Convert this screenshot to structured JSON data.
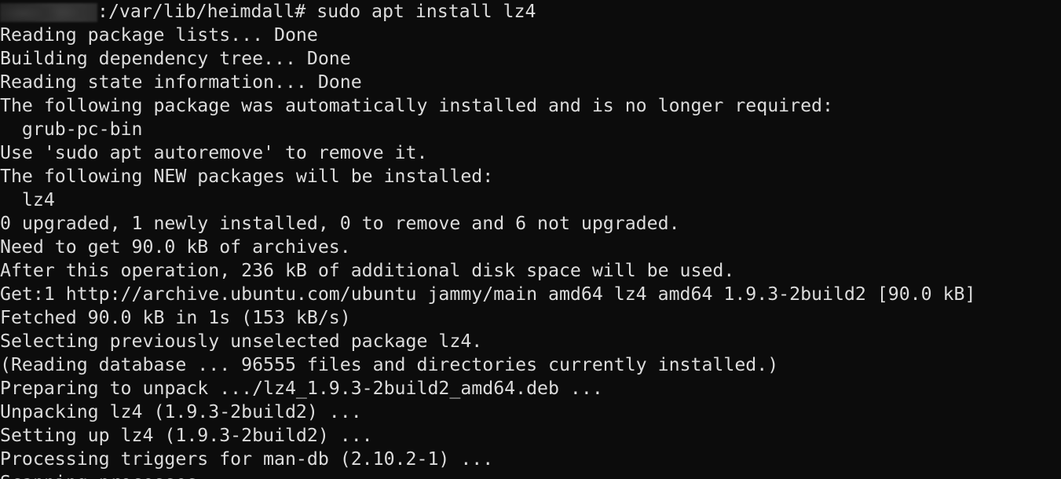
{
  "terminal": {
    "colors": {
      "background": "#0c0c0c",
      "foreground": "#dcdcdc",
      "redaction_block": "#333333"
    },
    "prompt": {
      "redacted_user_host": "",
      "path_and_command": ":/var/lib/heimdall# sudo apt install lz4",
      "cwd": "/var/lib/heimdall",
      "privilege_symbol": "#",
      "command": "sudo apt install lz4"
    },
    "output_lines": [
      "Reading package lists... Done",
      "Building dependency tree... Done",
      "Reading state information... Done",
      "The following package was automatically installed and is no longer required:",
      "  grub-pc-bin",
      "Use 'sudo apt autoremove' to remove it.",
      "The following NEW packages will be installed:",
      "  lz4",
      "0 upgraded, 1 newly installed, 0 to remove and 6 not upgraded.",
      "Need to get 90.0 kB of archives.",
      "After this operation, 236 kB of additional disk space will be used.",
      "Get:1 http://archive.ubuntu.com/ubuntu jammy/main amd64 lz4 amd64 1.9.3-2build2 [90.0 kB]",
      "Fetched 90.0 kB in 1s (153 kB/s)",
      "Selecting previously unselected package lz4.",
      "(Reading database ... 96555 files and directories currently installed.)",
      "Preparing to unpack .../lz4_1.9.3-2build2_amd64.deb ...",
      "Unpacking lz4 (1.9.3-2build2) ...",
      "Setting up lz4 (1.9.3-2build2) ...",
      "Processing triggers for man-db (2.10.2-1) ..."
    ],
    "clipped_line": "Scanning processes...",
    "stats": {
      "download_size": "90.0 kB",
      "disk_space": "236 kB",
      "download_time": "1s",
      "download_rate": "153 kB/s",
      "database_files": "96555",
      "upgraded": "0",
      "newly_installed": "1",
      "to_remove": "0",
      "not_upgraded": "6",
      "package_name": "lz4",
      "package_version": "1.9.3-2build2",
      "architecture": "amd64",
      "suite": "jammy/main",
      "mirror": "http://archive.ubuntu.com/ubuntu"
    }
  }
}
